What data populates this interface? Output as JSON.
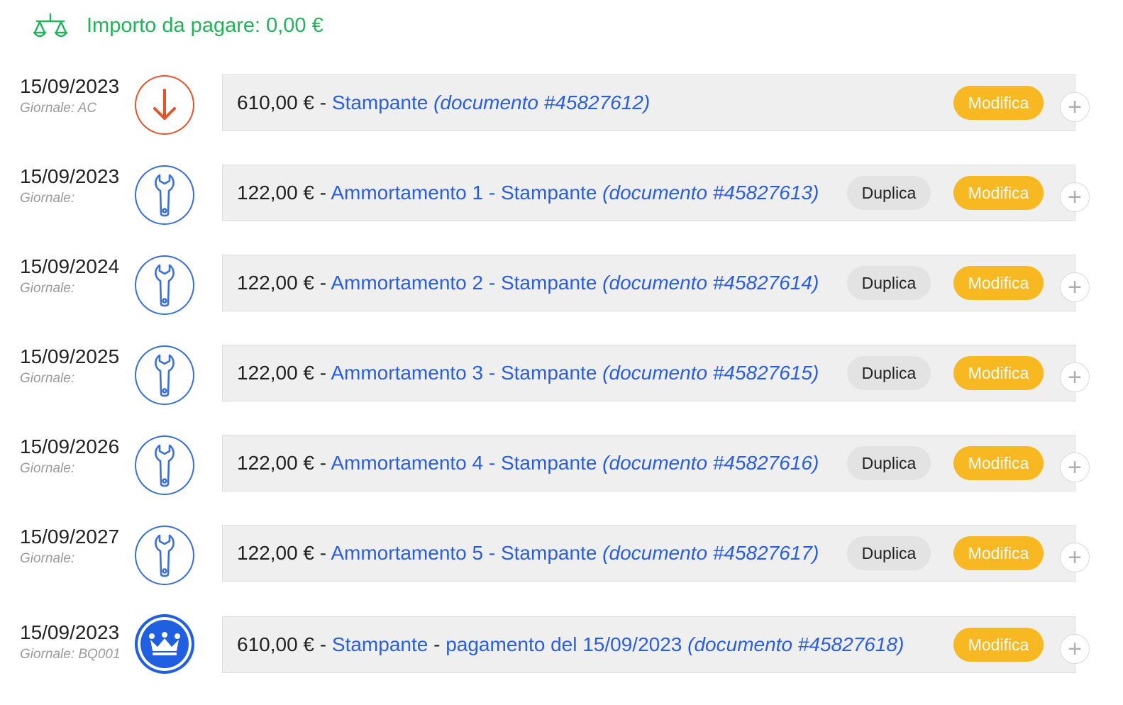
{
  "header": {
    "title": "Importo da pagare: 0,00 €",
    "icon": "scale-icon"
  },
  "colors": {
    "header_green": "#22b35a",
    "link_blue": "#2a5ee0",
    "modifica_yellow": "#f7b822",
    "duplica_gray": "#e3e3e3",
    "orange": "#e0552c",
    "blue": "#3a6fd6"
  },
  "rows": [
    {
      "date": "15/09/2023",
      "journal": "Giornale: AC",
      "icon": "arrow-down-icon",
      "amount": "610,00 €",
      "sep1": "-",
      "link": "Stampante",
      "sep2": "",
      "link2": "",
      "doc": "(documento #45827612)",
      "duplica": "",
      "modifica": "Modifica",
      "plus": "+"
    },
    {
      "date": "15/09/2023",
      "journal": "Giornale:",
      "icon": "wrench-icon",
      "amount": "122,00 €",
      "sep1": "-",
      "link": "Ammortamento 1 - Stampante",
      "sep2": "",
      "link2": "",
      "doc": "(documento #45827613)",
      "duplica": "Duplica",
      "modifica": "Modifica",
      "plus": "+"
    },
    {
      "date": "15/09/2024",
      "journal": "Giornale:",
      "icon": "wrench-icon",
      "amount": "122,00 €",
      "sep1": "-",
      "link": "Ammortamento 2 - Stampante",
      "sep2": "",
      "link2": "",
      "doc": "(documento #45827614)",
      "duplica": "Duplica",
      "modifica": "Modifica",
      "plus": "+"
    },
    {
      "date": "15/09/2025",
      "journal": "Giornale:",
      "icon": "wrench-icon",
      "amount": "122,00 €",
      "sep1": "-",
      "link": "Ammortamento 3 - Stampante",
      "sep2": "",
      "link2": "",
      "doc": "(documento #45827615)",
      "duplica": "Duplica",
      "modifica": "Modifica",
      "plus": "+"
    },
    {
      "date": "15/09/2026",
      "journal": "Giornale:",
      "icon": "wrench-icon",
      "amount": "122,00 €",
      "sep1": "-",
      "link": "Ammortamento 4 - Stampante",
      "sep2": "",
      "link2": "",
      "doc": "(documento #45827616)",
      "duplica": "Duplica",
      "modifica": "Modifica",
      "plus": "+"
    },
    {
      "date": "15/09/2027",
      "journal": "Giornale:",
      "icon": "wrench-icon",
      "amount": "122,00 €",
      "sep1": "-",
      "link": "Ammortamento 5 - Stampante",
      "sep2": "",
      "link2": "",
      "doc": "(documento #45827617)",
      "duplica": "Duplica",
      "modifica": "Modifica",
      "plus": "+"
    },
    {
      "date": "15/09/2023",
      "journal": "Giornale: BQ001",
      "icon": "crown-icon",
      "amount": "610,00 €",
      "sep1": "-",
      "link": "Stampante",
      "sep2": "-",
      "link2": "pagamento del 15/09/2023",
      "doc": "(documento #45827618)",
      "duplica": "",
      "modifica": "Modifica",
      "plus": "+"
    }
  ]
}
